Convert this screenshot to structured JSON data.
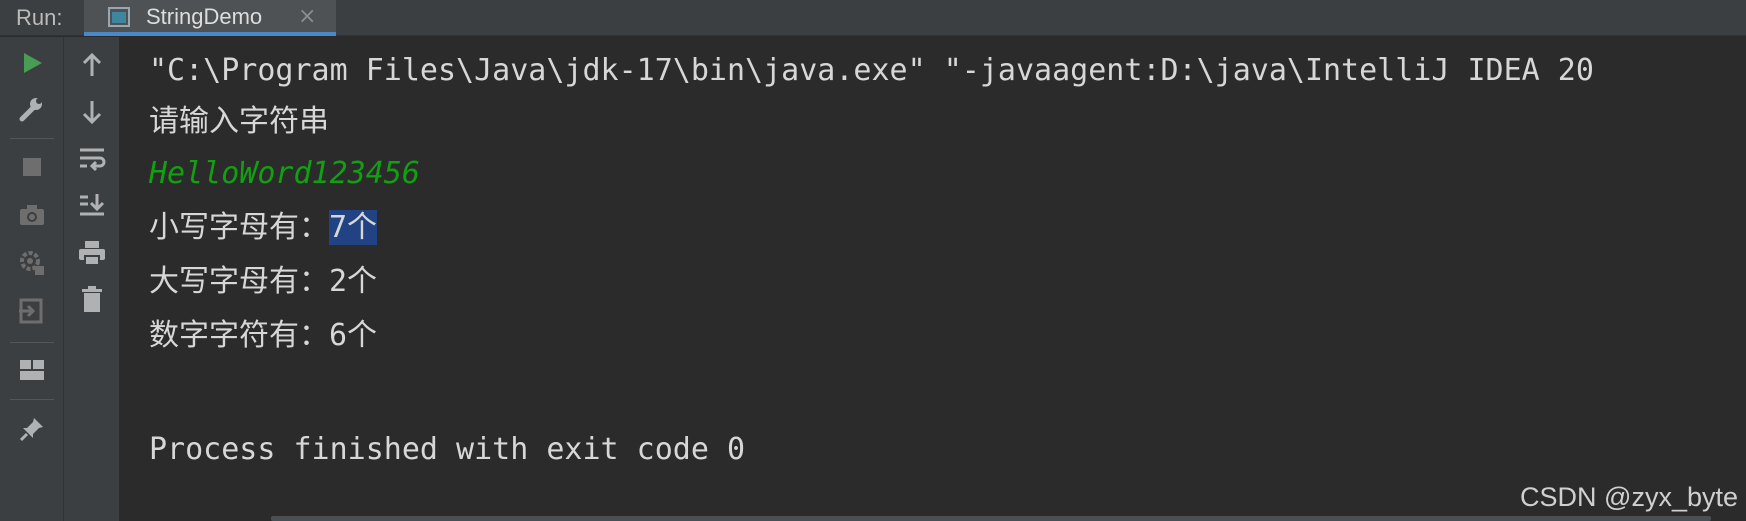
{
  "header": {
    "run_label": "Run:",
    "tab_label": "StringDemo",
    "tab_close": "×"
  },
  "toolbar_left": [
    {
      "name": "rerun-icon"
    },
    {
      "name": "wrench-icon"
    },
    {
      "name": "stop-icon"
    },
    {
      "name": "camera-icon"
    },
    {
      "name": "settings-icon"
    },
    {
      "name": "exit-icon"
    },
    {
      "name": "layout-icon"
    },
    {
      "name": "pin-icon"
    }
  ],
  "toolbar_right": [
    {
      "name": "up-arrow-icon"
    },
    {
      "name": "down-arrow-icon"
    },
    {
      "name": "soft-wrap-icon"
    },
    {
      "name": "scroll-to-end-icon"
    },
    {
      "name": "print-icon"
    },
    {
      "name": "trash-icon"
    }
  ],
  "console": {
    "cmd_line": "\"C:\\Program Files\\Java\\jdk-17\\bin\\java.exe\" \"-javaagent:D:\\java\\IntelliJ IDEA 20",
    "prompt": "请输入字符串",
    "user_input": "HelloWord123456",
    "lower_prefix": "小写字母有：",
    "lower_value": "7个",
    "upper_line": "大写字母有：2个",
    "digit_line": "数字字符有：6个",
    "exit_line": "Process finished with exit code 0"
  },
  "watermark": "CSDN @zyx_byte",
  "colors": {
    "run_green": "#499c54",
    "icon_gray": "#afb1b3",
    "selection": "#214283",
    "input_green": "#10a010"
  }
}
